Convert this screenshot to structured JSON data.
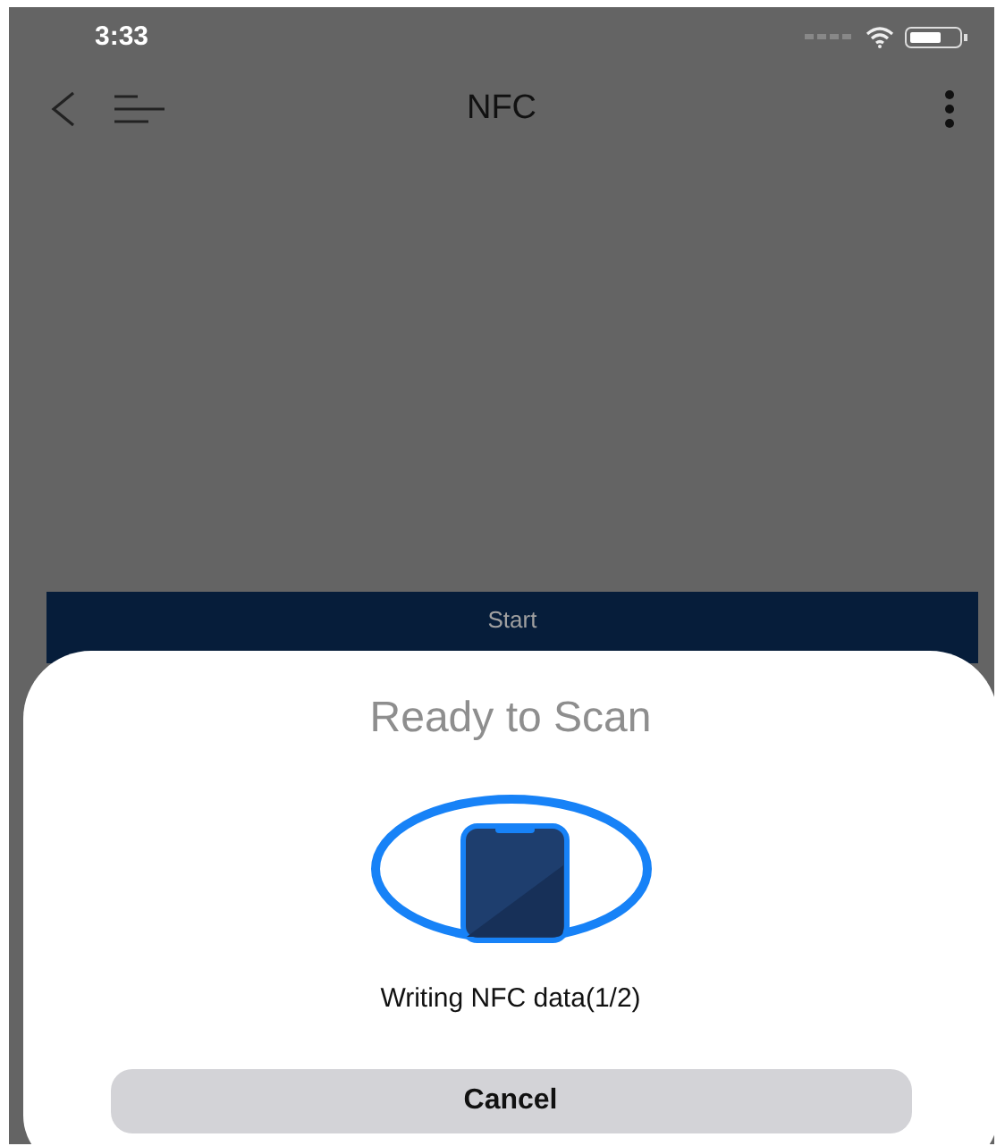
{
  "status_bar": {
    "time": "3:33"
  },
  "nav": {
    "title": "NFC"
  },
  "start_button": {
    "label": "Start"
  },
  "scan_sheet": {
    "title": "Ready to Scan",
    "message": "Writing NFC data(1/2)",
    "cancel": "Cancel"
  }
}
